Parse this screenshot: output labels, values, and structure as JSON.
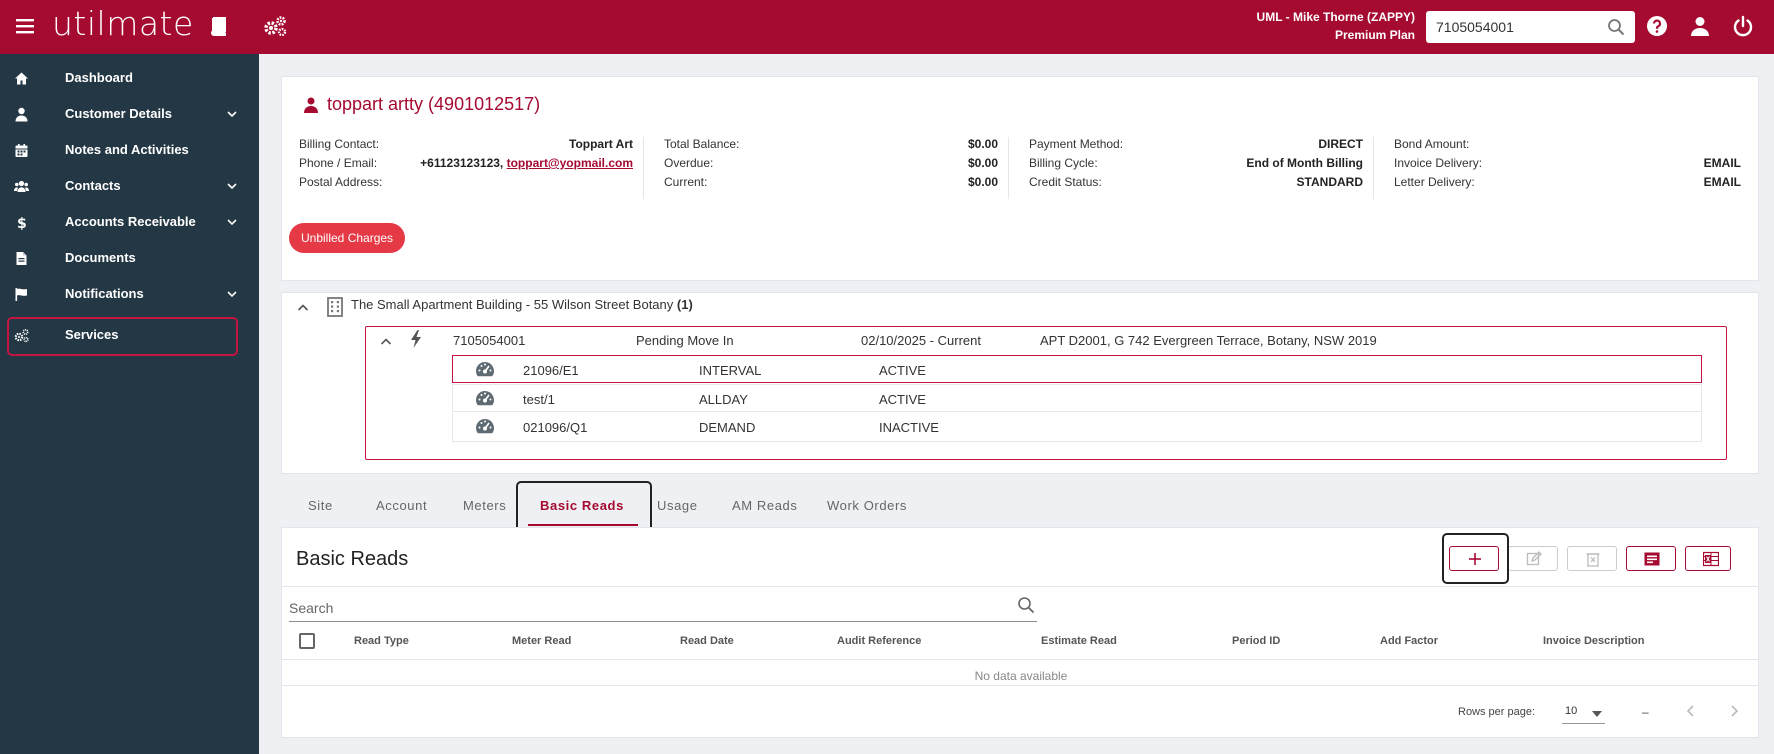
{
  "header": {
    "logo_text": "utilmate",
    "user_line1": "UML - Mike Thorne (ZAPPY)",
    "user_line2": "Premium Plan",
    "search_value": "7105054001",
    "brand_color": "#a50a30"
  },
  "sidebar": {
    "items": [
      {
        "label": "Dashboard",
        "icon": "home-icon"
      },
      {
        "label": "Customer Details",
        "icon": "person-icon",
        "has_chevron": true
      },
      {
        "label": "Notes and Activities",
        "icon": "calendar-icon"
      },
      {
        "label": "Contacts",
        "icon": "people-icon",
        "has_chevron": true
      },
      {
        "label": "Accounts Receivable",
        "icon": "dollar-icon",
        "has_chevron": true
      },
      {
        "label": "Documents",
        "icon": "document-icon"
      },
      {
        "label": "Notifications",
        "icon": "flag-icon",
        "has_chevron": true
      },
      {
        "label": "Services",
        "icon": "gears-icon",
        "active": true
      }
    ]
  },
  "customer": {
    "title": "toppart artty (4901012517)",
    "billing_contact_label": "Billing Contact:",
    "billing_contact": "Toppart Art",
    "phone_email_label": "Phone / Email:",
    "phone": "+61123123123,",
    "email": "toppart@yopmail.com",
    "postal_address_label": "Postal Address:",
    "postal_address": "",
    "total_balance_label": "Total Balance:",
    "total_balance": "$0.00",
    "overdue_label": "Overdue:",
    "overdue": "$0.00",
    "current_label": "Current:",
    "current": "$0.00",
    "payment_method_label": "Payment Method:",
    "payment_method": "DIRECT",
    "billing_cycle_label": "Billing Cycle:",
    "billing_cycle": "End of Month Billing",
    "credit_status_label": "Credit Status:",
    "credit_status": "STANDARD",
    "bond_amount_label": "Bond Amount:",
    "bond_amount": "",
    "invoice_delivery_label": "Invoice Delivery:",
    "invoice_delivery": "EMAIL",
    "letter_delivery_label": "Letter Delivery:",
    "letter_delivery": "EMAIL",
    "unbilled_button": "Unbilled Charges"
  },
  "site": {
    "name": "The Small Apartment Building - 55 Wilson Street Botany",
    "count": "(1)",
    "nmi": {
      "id": "7105054001",
      "status": "Pending Move In",
      "period": "02/10/2025 - Current",
      "address": "APT D2001, G 742 Evergreen Terrace, Botany, NSW 2019"
    },
    "meters": [
      {
        "id": "21096/E1",
        "type": "INTERVAL",
        "status": "ACTIVE",
        "selected": true
      },
      {
        "id": "test/1",
        "type": "ALLDAY",
        "status": "ACTIVE"
      },
      {
        "id": "021096/Q1",
        "type": "DEMAND",
        "status": "INACTIVE"
      }
    ]
  },
  "tabs": [
    {
      "label": "Site"
    },
    {
      "label": "Account"
    },
    {
      "label": "Meters"
    },
    {
      "label": "Basic Reads",
      "active": true
    },
    {
      "label": "Usage"
    },
    {
      "label": "AM Reads"
    },
    {
      "label": "Work Orders"
    }
  ],
  "reads": {
    "title": "Basic Reads",
    "search_placeholder": "Search",
    "columns": [
      "Read Type",
      "Meter Read",
      "Read Date",
      "Audit Reference",
      "Estimate Read",
      "Period ID",
      "Add Factor",
      "Invoice Description"
    ],
    "no_data": "No data available",
    "rows_per_page_label": "Rows per page:",
    "rows_per_page": "10",
    "page_range": "–"
  }
}
